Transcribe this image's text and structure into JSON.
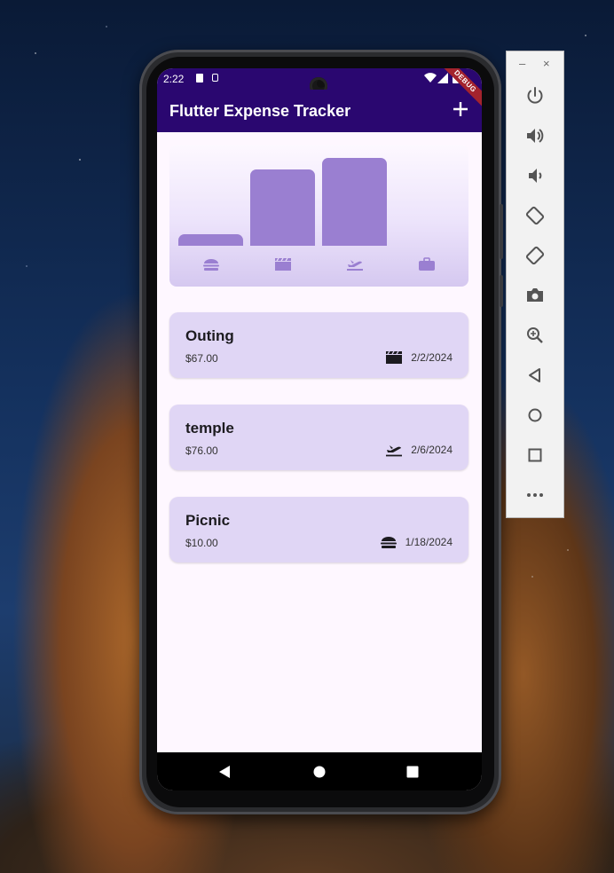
{
  "status_bar": {
    "time": "2:22"
  },
  "app_bar": {
    "title": "Flutter Expense Tracker",
    "add_icon": "plus-icon",
    "debug_banner": "DEBUG"
  },
  "chart": {
    "categories": [
      "food",
      "leisure",
      "travel",
      "work"
    ],
    "icons": [
      "burger-icon",
      "movie-clapper-icon",
      "flight-takeoff-icon",
      "briefcase-icon"
    ],
    "bucket_totals": [
      10,
      67,
      76,
      0
    ],
    "fill_fractions": [
      0.13,
      0.87,
      1.0,
      0
    ],
    "bar_color": "#9a7fd1"
  },
  "expenses": [
    {
      "title": "Outing",
      "amount": "$67.00",
      "date": "2/2/2024",
      "category": "leisure",
      "icon": "movie-clapper-icon"
    },
    {
      "title": "temple",
      "amount": "$76.00",
      "date": "2/6/2024",
      "category": "travel",
      "icon": "flight-takeoff-icon"
    },
    {
      "title": "Picnic",
      "amount": "$10.00",
      "date": "1/18/2024",
      "category": "food",
      "icon": "burger-icon"
    }
  ],
  "nav_bar": {
    "buttons": [
      "back-icon",
      "home-icon",
      "recents-icon"
    ]
  },
  "emulator_panel": {
    "window_controls": [
      "minimize-icon",
      "close-icon"
    ],
    "buttons": [
      "power-icon",
      "volume-up-icon",
      "volume-down-icon",
      "rotate-left-icon",
      "rotate-right-icon",
      "camera-icon",
      "zoom-icon",
      "back-icon",
      "home-icon",
      "overview-icon",
      "more-icon"
    ]
  },
  "colors": {
    "app_bar": "#2a0770",
    "screen_bg": "#fef7ff",
    "card_bg": "#e0d6f5",
    "accent": "#9a7fd1"
  }
}
